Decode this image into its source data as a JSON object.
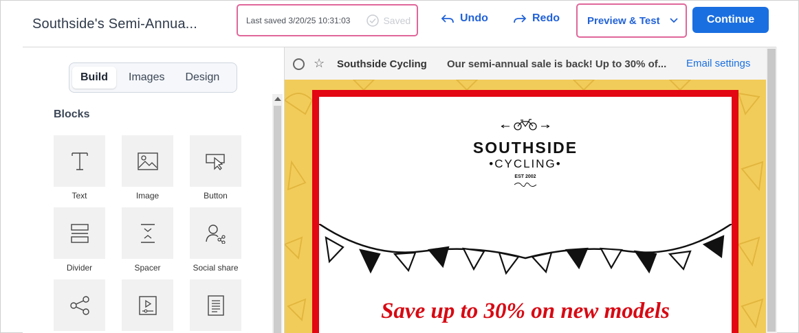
{
  "doc_title": "Southside's Semi-Annua...",
  "save": {
    "last_saved": "Last saved 3/20/25 10:31:03",
    "status": "Saved"
  },
  "toolbar": {
    "undo": "Undo",
    "redo": "Redo",
    "preview_test": "Preview & Test",
    "continue": "Continue"
  },
  "tabs": [
    "Build",
    "Images",
    "Design"
  ],
  "blocks_heading": "Blocks",
  "blocks": [
    {
      "label": "Text",
      "icon": "text-icon"
    },
    {
      "label": "Image",
      "icon": "image-icon"
    },
    {
      "label": "Button",
      "icon": "button-cursor-icon"
    },
    {
      "label": "Divider",
      "icon": "divider-icon"
    },
    {
      "label": "Spacer",
      "icon": "spacer-icon"
    },
    {
      "label": "Social share",
      "icon": "social-share-icon"
    },
    {
      "label": "",
      "icon": "share-icon"
    },
    {
      "label": "",
      "icon": "video-icon"
    },
    {
      "label": "",
      "icon": "document-icon"
    }
  ],
  "mail": {
    "sender": "Southside Cycling",
    "subject": "Our semi-annual sale is back! Up to 30% of...",
    "email_settings": "Email settings"
  },
  "email": {
    "logo_word": "SOUTHSIDE",
    "logo_sub": "•CYCLING•",
    "logo_est": "EST 2002",
    "headline": "Save up to 30% on new models"
  },
  "colors": {
    "accent": "#1a6fe0",
    "highlight_border": "#e0669a",
    "email_bg": "#f2cc5a",
    "email_frame": "#e30613",
    "headline": "#d70913"
  }
}
